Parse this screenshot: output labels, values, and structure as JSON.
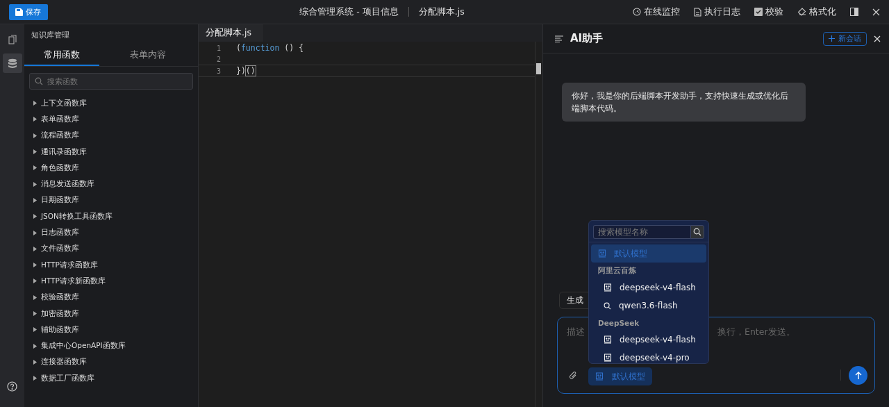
{
  "toolbar": {
    "save_label": "保存",
    "title": "综合管理系统 - 项目信息",
    "file_name": "分配脚本.js",
    "actions": [
      {
        "kind": "monitor",
        "label": "在线监控"
      },
      {
        "kind": "log",
        "label": "执行日志"
      },
      {
        "kind": "check",
        "label": "校验"
      },
      {
        "kind": "format",
        "label": "格式化"
      }
    ]
  },
  "rail": [
    {
      "kind": "files",
      "selected": false
    },
    {
      "kind": "database",
      "selected": true
    }
  ],
  "sidebar": {
    "title": "知识库管理",
    "tabs": [
      {
        "label": "常用函数",
        "selected": true
      },
      {
        "label": "表单内容",
        "selected": false
      }
    ],
    "search": {
      "placeholder": "搜索函数"
    },
    "items": [
      "上下文函数库",
      "表单函数库",
      "流程函数库",
      "通讯录函数库",
      "角色函数库",
      "消息发送函数库",
      "日期函数库",
      "JSON转换工具函数库",
      "日志函数库",
      "文件函数库",
      "HTTP请求函数库",
      "HTTP请求新函数库",
      "校验函数库",
      "加密函数库",
      "辅助函数库",
      "集成中心OpenAPI函数库",
      "连接器函数库",
      "数据工厂函数库"
    ]
  },
  "editor": {
    "tab": "分配脚本.js",
    "lines": [
      {
        "number": "1",
        "code": [
          {
            "kind": "punct",
            "text": "("
          },
          {
            "kind": "keyword",
            "text": "function"
          },
          {
            "kind": "punct",
            "text": " () {"
          }
        ]
      },
      {
        "number": "2"
      },
      {
        "number": "3",
        "code": [
          {
            "kind": "punct",
            "text": "})"
          },
          {
            "kind": "bracket",
            "text": "()"
          }
        ]
      }
    ]
  },
  "assistant": {
    "title": "AI助手",
    "new_chat": "新会话",
    "message": "你好，我是你的后端脚本开发助手，支持快速生成或优化后端脚本代码。",
    "chip": "生成",
    "input_placeholder_start": "描述",
    "input_placeholder_end": "换行，Enter发送。",
    "model_button": "默认模型",
    "model_menu": {
      "search": {
        "placeholder": "搜索模型名称"
      },
      "entries": [
        {
          "kind": "model",
          "label": "默认模型",
          "selected": true
        },
        {
          "kind": "group",
          "label": "阿里云百炼"
        },
        {
          "kind": "model",
          "label": "deepseek-v4-flash",
          "selected": false
        },
        {
          "kind": "searchmodel",
          "label": "qwen3.6-flash",
          "selected": false
        },
        {
          "kind": "group",
          "label": "DeepSeek"
        },
        {
          "kind": "model",
          "label": "deepseek-v4-flash",
          "selected": false
        },
        {
          "kind": "model",
          "label": "deepseek-v4-pro",
          "selected": false
        }
      ]
    }
  }
}
